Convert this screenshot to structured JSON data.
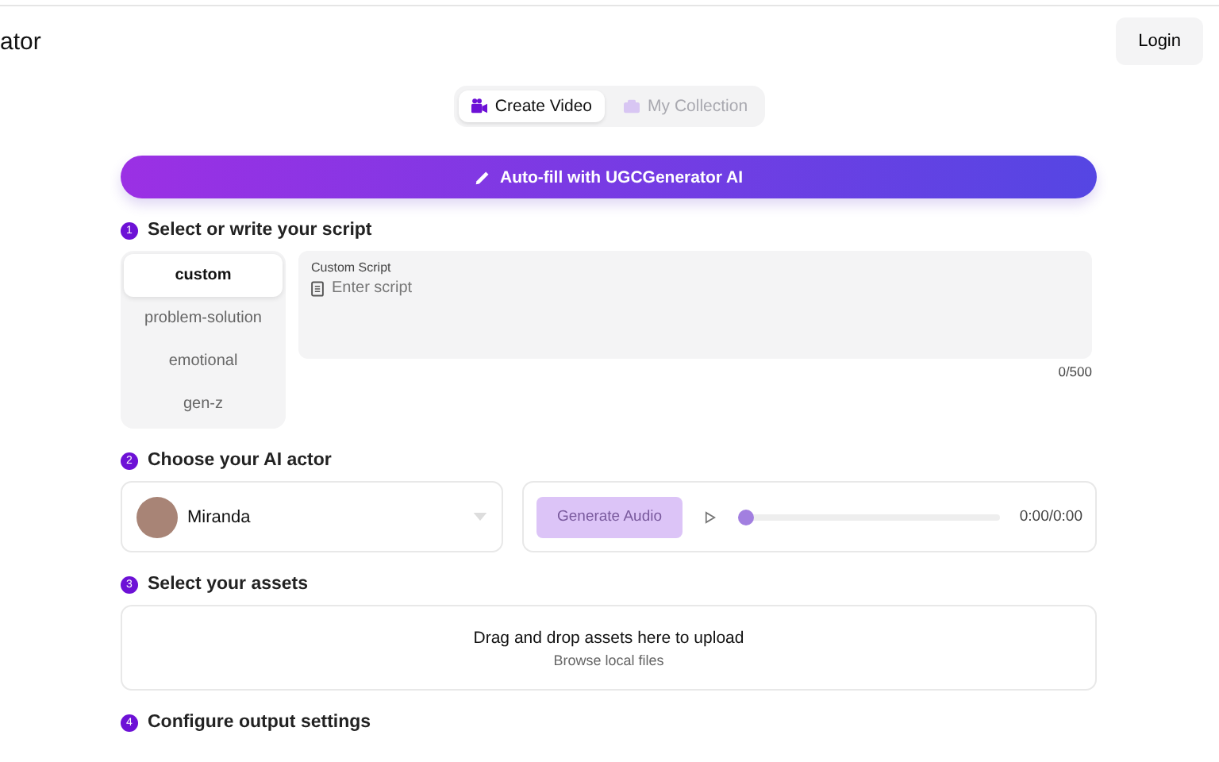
{
  "header": {
    "title": "ator",
    "login": "Login"
  },
  "tabs": [
    {
      "label": "Create Video",
      "selected": true,
      "disabled": false
    },
    {
      "label": "My Collection",
      "selected": false,
      "disabled": true
    }
  ],
  "autofill": {
    "label": "Auto-fill with UGCGenerator AI"
  },
  "script_section": {
    "number": "1",
    "title": "Select or write your script",
    "templates": [
      {
        "label": "custom",
        "selected": true
      },
      {
        "label": "problem-solution",
        "selected": false
      },
      {
        "label": "emotional",
        "selected": false
      },
      {
        "label": "gen-z",
        "selected": false
      }
    ],
    "field_label": "Custom Script",
    "placeholder": "Enter script",
    "counter": "0/500"
  },
  "actor_section": {
    "number": "2",
    "title": "Choose your AI actor",
    "actor": "Miranda",
    "generate": {
      "label": "Generate Audio",
      "disabled": true
    },
    "audio": {
      "level": 0,
      "time": "0:00/0:00"
    }
  },
  "assets_section": {
    "number": "3",
    "title": "Select your assets",
    "drop_text": "Drag and drop assets here to upload",
    "browse": "Browse local files"
  },
  "output_section": {
    "number": "4",
    "title": "Configure output settings"
  }
}
